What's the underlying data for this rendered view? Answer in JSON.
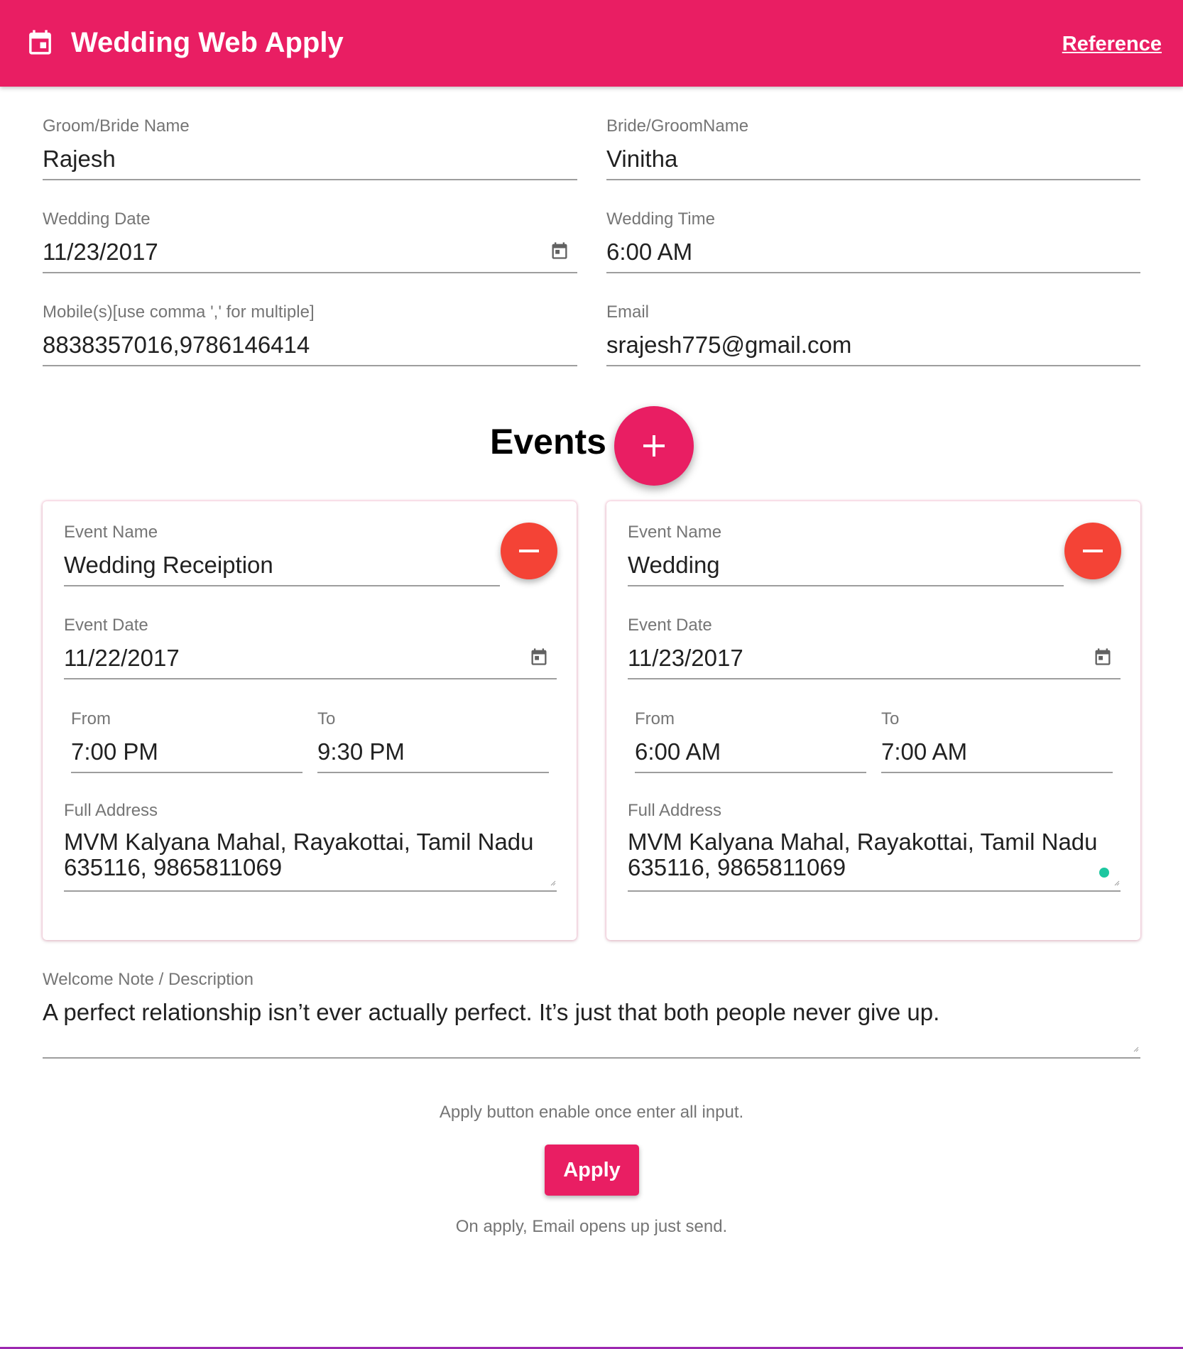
{
  "header": {
    "title": "Wedding Web Apply",
    "reference_link": "Reference",
    "background": "#E91E63",
    "icon": "calendar-icon"
  },
  "form": {
    "groom_bride_name": {
      "label": "Groom/Bride Name",
      "value": "Rajesh"
    },
    "bride_groom_name": {
      "label": "Bride/GroomName",
      "value": "Vinitha"
    },
    "wedding_date": {
      "label": "Wedding Date",
      "value": "11/23/2017"
    },
    "wedding_time": {
      "label": "Wedding Time",
      "value": "6:00 AM"
    },
    "mobiles": {
      "label": "Mobile(s)[use comma ',' for multiple]",
      "value": "8838357016,9786146414"
    },
    "email": {
      "label": "Email",
      "value": "srajesh775@gmail.com"
    }
  },
  "events": {
    "title": "Events",
    "items": [
      {
        "name_label": "Event Name",
        "name": "Wedding Receiption",
        "date_label": "Event Date",
        "date": "11/22/2017",
        "from_label": "From",
        "from": "7:00 PM",
        "to_label": "To",
        "to": "9:30 PM",
        "address_label": "Full Address",
        "address": "MVM Kalyana Mahal, Rayakottai, Tamil Nadu 635116, 9865811069"
      },
      {
        "name_label": "Event Name",
        "name": "Wedding",
        "date_label": "Event Date",
        "date": "11/23/2017",
        "from_label": "From",
        "from": "6:00 AM",
        "to_label": "To",
        "to": "7:00 AM",
        "address_label": "Full Address",
        "address": "MVM Kalyana Mahal, Rayakottai, Tamil Nadu 635116, 9865811069"
      }
    ]
  },
  "welcome_note": {
    "label": "Welcome Note / Description",
    "value": "A perfect relationship isn’t ever actually perfect. It’s just that both people never give up."
  },
  "footer": {
    "hint_top": "Apply button enable once enter all input.",
    "apply_label": "Apply",
    "hint_bottom": "On apply, Email opens up just send."
  },
  "colors": {
    "primary": "#E91E63",
    "remove_fab": "#F44336",
    "label_text": "#757575",
    "underline": "#9e9e9e",
    "status_dot": "#1DC7A0"
  }
}
